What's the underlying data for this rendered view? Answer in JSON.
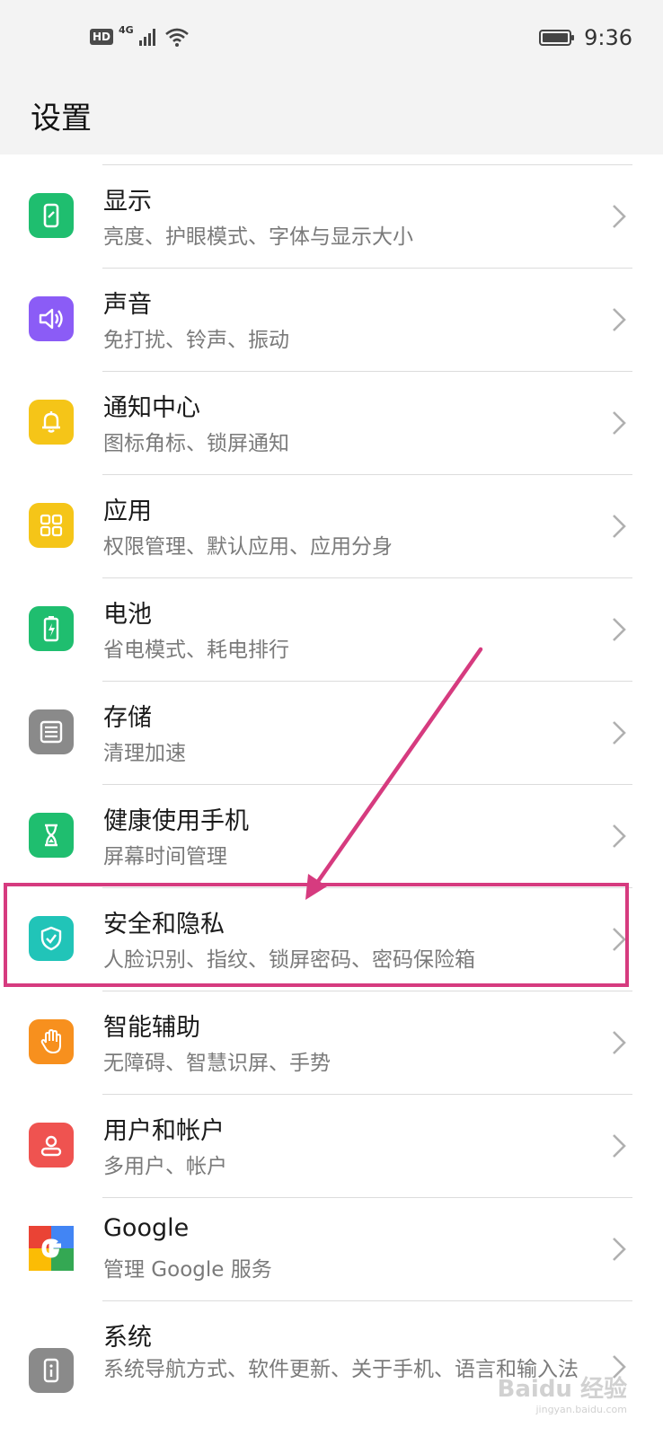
{
  "status_bar": {
    "hd_label": "HD",
    "network_label": "4G",
    "time": "9:36"
  },
  "header": {
    "title": "设置"
  },
  "settings": [
    {
      "id": "display",
      "title": "显示",
      "subtitle": "亮度、护眼模式、字体与显示大小",
      "icon": "display-icon",
      "color": "#1fbe6f"
    },
    {
      "id": "sound",
      "title": "声音",
      "subtitle": "免打扰、铃声、振动",
      "icon": "speaker-icon",
      "color": "#8b5cf6"
    },
    {
      "id": "notifications",
      "title": "通知中心",
      "subtitle": "图标角标、锁屏通知",
      "icon": "bell-icon",
      "color": "#f5c518"
    },
    {
      "id": "apps",
      "title": "应用",
      "subtitle": "权限管理、默认应用、应用分身",
      "icon": "apps-grid-icon",
      "color": "#f5c518"
    },
    {
      "id": "battery",
      "title": "电池",
      "subtitle": "省电模式、耗电排行",
      "icon": "battery-icon",
      "color": "#1fbe6f"
    },
    {
      "id": "storage",
      "title": "存储",
      "subtitle": "清理加速",
      "icon": "storage-icon",
      "color": "#8a8a8a"
    },
    {
      "id": "digital-balance",
      "title": "健康使用手机",
      "subtitle": "屏幕时间管理",
      "icon": "hourglass-icon",
      "color": "#1fbe6f"
    },
    {
      "id": "security",
      "title": "安全和隐私",
      "subtitle": "人脸识别、指纹、锁屏密码、密码保险箱",
      "icon": "shield-icon",
      "color": "#21c4b8"
    },
    {
      "id": "accessibility",
      "title": "智能辅助",
      "subtitle": "无障碍、智慧识屏、手势",
      "icon": "hand-icon",
      "color": "#f7901e"
    },
    {
      "id": "accounts",
      "title": "用户和帐户",
      "subtitle": "多用户、帐户",
      "icon": "user-icon",
      "color": "#ef5350"
    },
    {
      "id": "google",
      "title": "Google",
      "subtitle": "管理 Google 服务",
      "icon": "google-icon",
      "color": "#ffffff"
    },
    {
      "id": "system",
      "title": "系统",
      "subtitle": "系统导航方式、软件更新、关于手机、语言和输入法",
      "icon": "system-info-icon",
      "color": "#8a8a8a"
    }
  ],
  "watermark": {
    "text": "Baidu 经验",
    "url_text": "jingyan.baidu.com"
  }
}
